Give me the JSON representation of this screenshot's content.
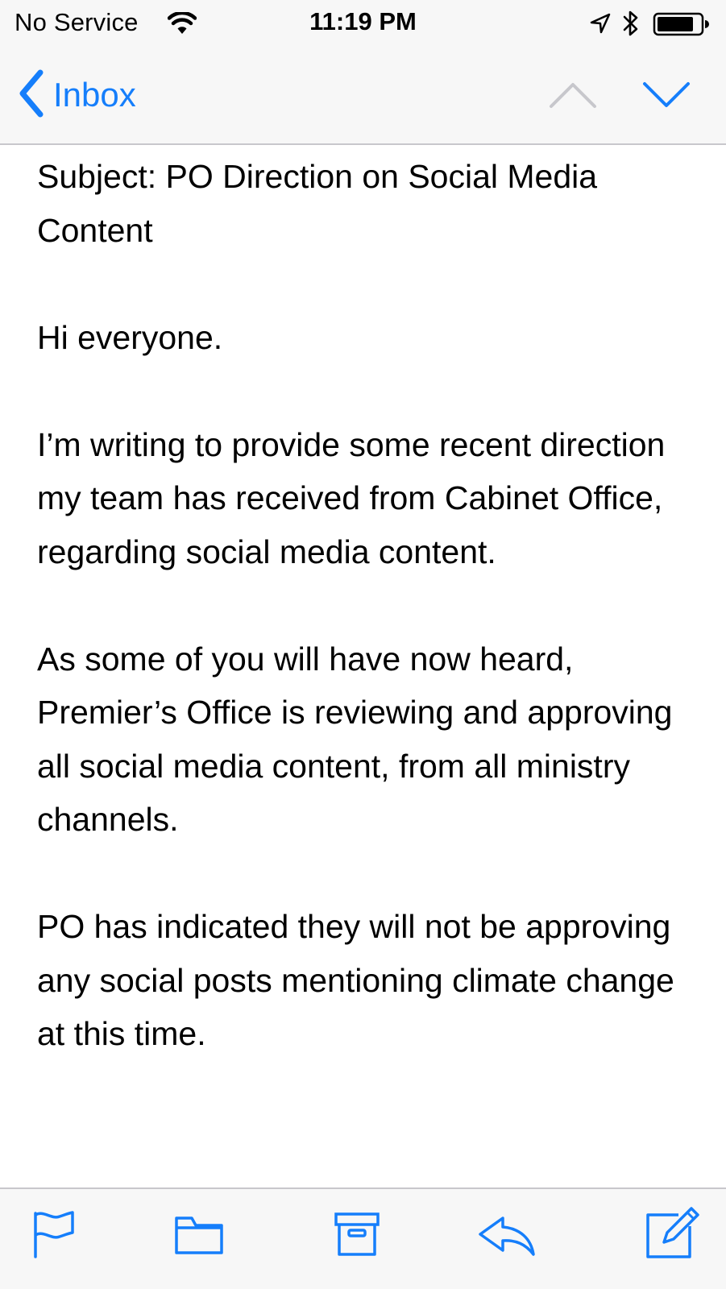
{
  "status_bar": {
    "carrier": "No Service",
    "time": "11:19 PM",
    "icons": [
      "wifi-icon",
      "location-arrow-icon",
      "bluetooth-icon",
      "battery-icon"
    ]
  },
  "nav": {
    "back_label": "Inbox",
    "prev_icon": "chevron-up-icon",
    "next_icon": "chevron-down-icon",
    "prev_enabled": false,
    "next_enabled": true
  },
  "message": {
    "subject_line": "Subject: PO Direction on Social Media Content",
    "greeting": "Hi everyone.",
    "paragraphs": [
      "I’m writing to provide some recent direction my team has received from Cabinet Office, regarding social media content.",
      "As some of you will have now heard, Premier’s Office is reviewing and approving all social media content, from all ministry channels.",
      "PO has indicated they will not be approving any social posts mentioning climate change at this time."
    ]
  },
  "toolbar": {
    "icons": [
      "flag-icon",
      "folder-icon",
      "archive-icon",
      "reply-icon",
      "compose-icon"
    ]
  },
  "colors": {
    "tint": "#157efb",
    "disabled": "#c7c7cc",
    "chrome_bg": "#f7f7f7",
    "separator": "#c8c7cc"
  }
}
